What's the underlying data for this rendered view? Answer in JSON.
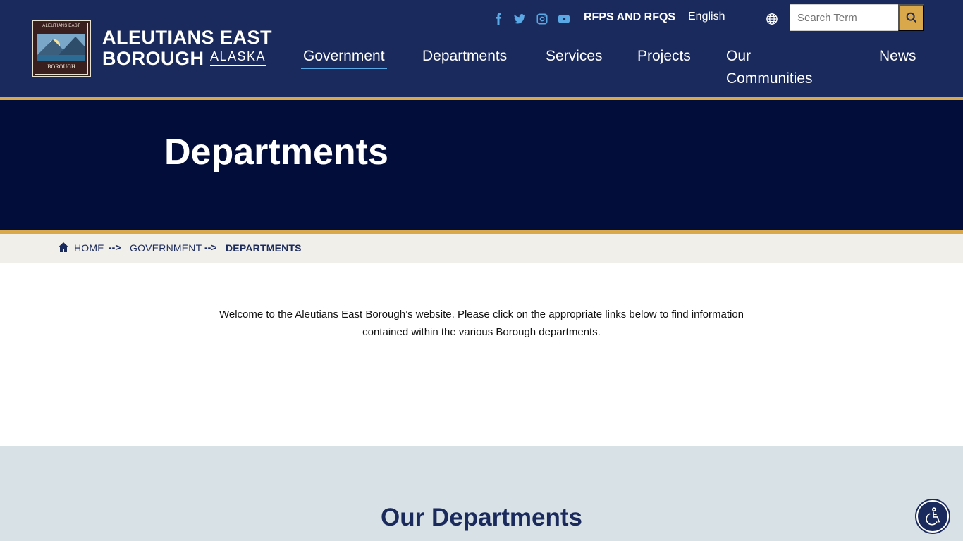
{
  "brand": {
    "line1": "ALEUTIANS EAST",
    "line2": "BOROUGH",
    "state": "ALASKA",
    "logo_top": "ALEUTIANS EAST",
    "logo_bottom": "BOROUGH"
  },
  "utility": {
    "social": [
      "facebook-icon",
      "twitter-icon",
      "instagram-icon",
      "youtube-icon"
    ],
    "rfps_label": "RFPS AND RFQS",
    "language": "English",
    "search_placeholder": "Search Term"
  },
  "nav": {
    "items": [
      {
        "label": "Government",
        "active": true
      },
      {
        "label": "Departments"
      },
      {
        "label": "Services"
      },
      {
        "label": "Projects"
      },
      {
        "label": "Our Communities"
      },
      {
        "label": "News"
      }
    ]
  },
  "hero": {
    "title": "Departments"
  },
  "breadcrumb": {
    "home": "HOME",
    "separator": "-->",
    "parent": "GOVERNMENT",
    "current": "DEPARTMENTS"
  },
  "intro": {
    "text": "Welcome to the Aleutians East Borough’s website. Please click on the appropriate links below to find information contained within the various Borough departments."
  },
  "departments": {
    "heading": "Our Departments"
  },
  "colors": {
    "header_bg": "#1b2a5c",
    "hero_bg": "#030d3a",
    "accent_gold": "#d9a84a",
    "social_blue": "#5aa9e6",
    "section_bg": "#d8e1e6"
  }
}
